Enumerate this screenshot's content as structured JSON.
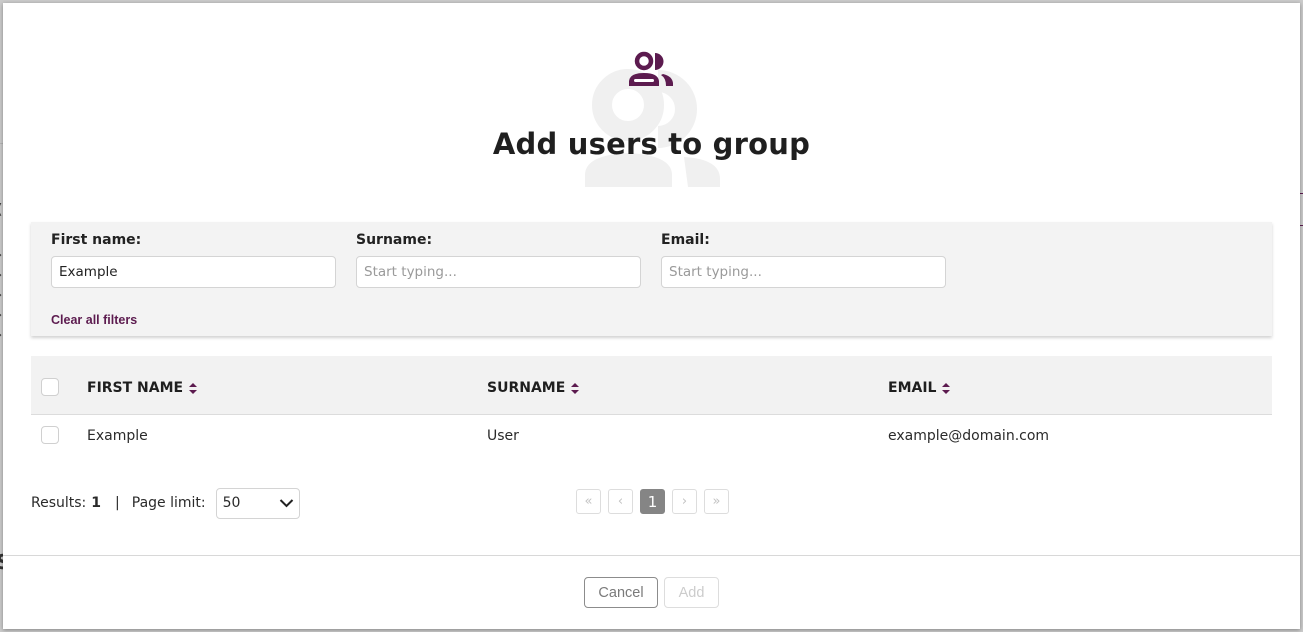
{
  "modal": {
    "title": "Add users to group",
    "header_icon": "users-group-icon"
  },
  "filters": {
    "first_name": {
      "label": "First name:",
      "value": "Example",
      "placeholder": "Start typing..."
    },
    "surname": {
      "label": "Surname:",
      "value": "",
      "placeholder": "Start typing..."
    },
    "email": {
      "label": "Email:",
      "value": "",
      "placeholder": "Start typing..."
    },
    "clear_all_label": "Clear all filters"
  },
  "table": {
    "columns": [
      {
        "key": "first_name",
        "label": "FIRST NAME",
        "sortable": true
      },
      {
        "key": "surname",
        "label": "SURNAME",
        "sortable": true
      },
      {
        "key": "email",
        "label": "EMAIL",
        "sortable": true
      }
    ],
    "rows": [
      {
        "first_name": "Example",
        "surname": "User",
        "email": "example@domain.com",
        "selected": false
      }
    ]
  },
  "footer": {
    "results_label": "Results:",
    "results_count": "1",
    "separator": "|",
    "page_limit_label": "Page limit:",
    "page_limit_value": "50"
  },
  "pagination": {
    "first": "«",
    "prev": "‹",
    "current_page": "1",
    "next": "›",
    "last": "»"
  },
  "actions": {
    "cancel_label": "Cancel",
    "add_label": "Add",
    "add_disabled": true
  },
  "colors": {
    "accent": "#5c1b4f",
    "filter_panel_bg": "#f3f3f3",
    "active_page_bg": "#858585"
  }
}
